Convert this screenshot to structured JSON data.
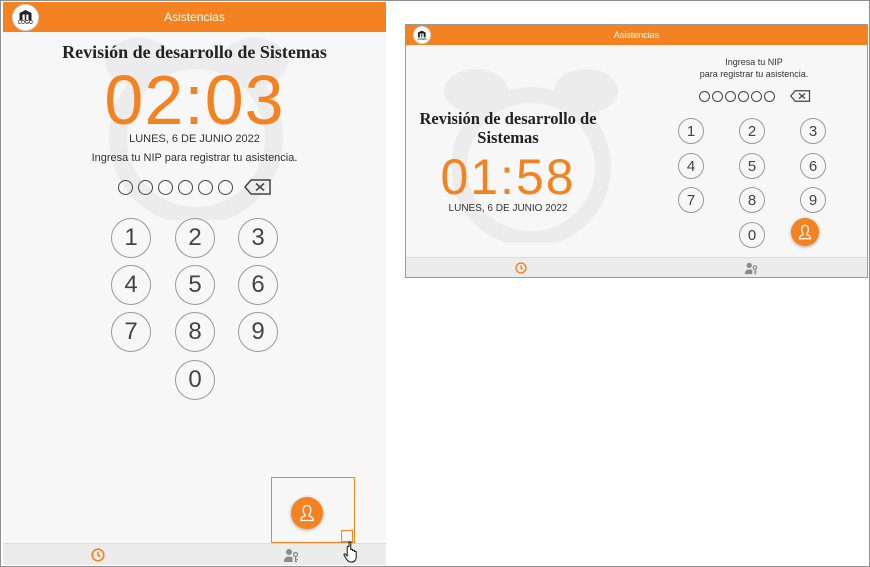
{
  "colors": {
    "accent": "#f58220",
    "background": "#f7f7f7",
    "bottom_bar": "#ececec"
  },
  "portrait": {
    "header": {
      "title": "Asistencias",
      "logo_text": "LOGO"
    },
    "event_title": "Revisión de desarrollo de Sistemas",
    "clock": "02:03",
    "date": "LUNES, 6 DE JUNIO 2022",
    "instruction": "Ingresa tu NIP para registrar tu asistencia.",
    "pin_length": 6,
    "keypad": [
      "1",
      "2",
      "3",
      "4",
      "5",
      "6",
      "7",
      "8",
      "9",
      "0"
    ],
    "tabs": [
      {
        "name": "clock-tab",
        "icon": "clock-icon"
      },
      {
        "name": "user-admin-tab",
        "icon": "user-key-icon"
      }
    ]
  },
  "landscape": {
    "header": {
      "title": "Asistencias",
      "logo_text": "LOGO"
    },
    "event_title": "Revisión de desarrollo de Sistemas",
    "clock": "01:58",
    "date": "LUNES, 6 DE JUNIO 2022",
    "instruction_line1": "Ingresa tu NIP",
    "instruction_line2": "para registrar tu asistencia.",
    "pin_length": 6,
    "keypad": [
      "1",
      "2",
      "3",
      "4",
      "5",
      "6",
      "7",
      "8",
      "9",
      "0"
    ],
    "tabs": [
      {
        "name": "clock-tab",
        "icon": "clock-icon"
      },
      {
        "name": "user-admin-tab",
        "icon": "user-key-icon"
      }
    ]
  }
}
